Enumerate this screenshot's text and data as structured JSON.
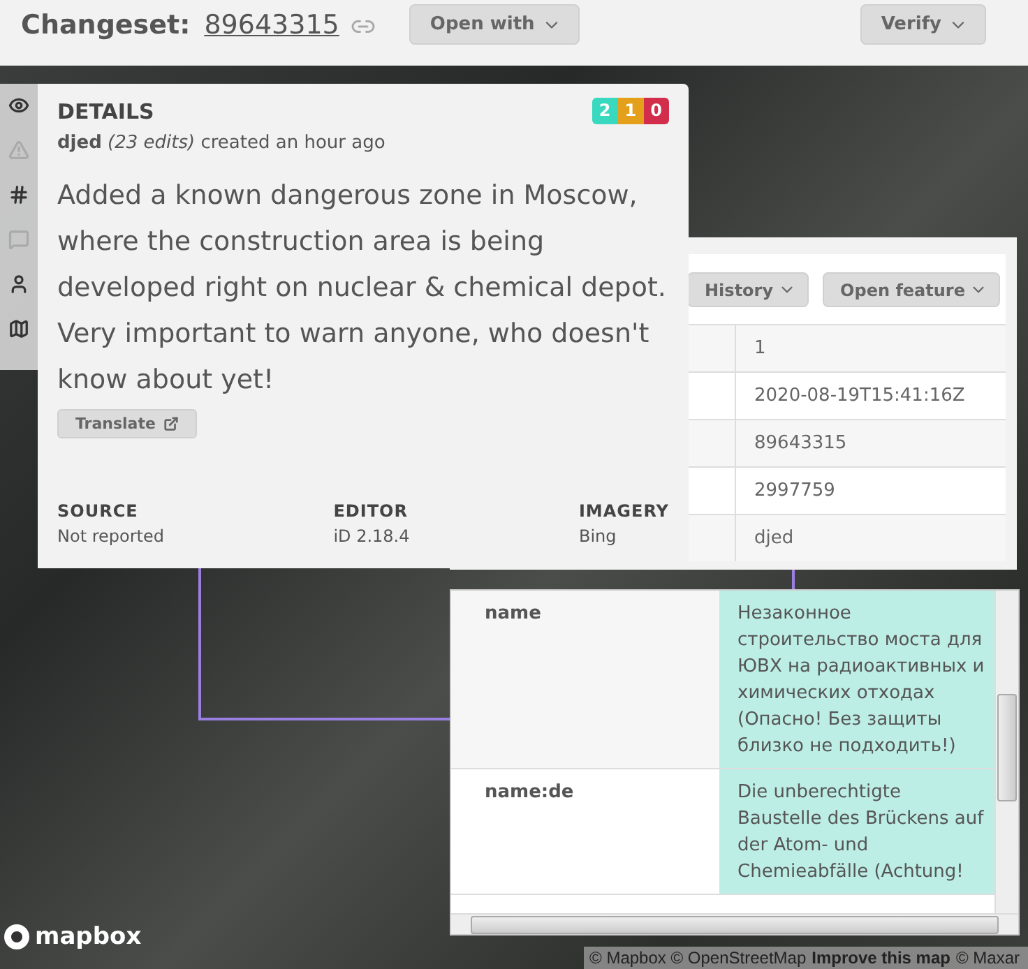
{
  "header": {
    "title": "Changeset:",
    "changeset_id": "89643315",
    "buttons": [
      "Open with",
      "Verify"
    ]
  },
  "details": {
    "title": "DETAILS",
    "badges": [
      {
        "count": "2",
        "color": "#39d9bf"
      },
      {
        "count": "1",
        "color": "#e5a01b"
      },
      {
        "count": "0",
        "color": "#d22e4b"
      }
    ],
    "meta": "**djed** *(23 edits)* created an hour ago",
    "comment": "Added a known dangerous zone in Moscow, where the construction area is being developed right on nuclear & chemical depot. Very important to warn anyone, who doesn't know about yet!",
    "translate_button": "Translate",
    "fields": [
      {
        "label": "SOURCE",
        "value": "Not reported"
      },
      {
        "label": "EDITOR",
        "value": "iD 2.18.4"
      },
      {
        "label": "IMAGERY",
        "value": "Bing"
      }
    ]
  },
  "feature": {
    "buttons": [
      "History",
      "Open feature"
    ],
    "values": [
      "1",
      "2020-08-19T15:41:16Z",
      "89643315",
      "2997759",
      "djed"
    ]
  },
  "tags": {
    "rows": [
      {
        "key": "name",
        "value": "Незаконное строительство моста для ЮВХ на радиоактивных и химических отходах (Опасно! Без защиты близко не подходить!)"
      },
      {
        "key": "name:de",
        "value": "Die unberechtigte Baustelle des Brückens auf der Atom- und Chemieabfälle (Achtung!"
      }
    ]
  },
  "map": {
    "logo": "mapbox",
    "attribution": {
      "before": "© Mapbox © OpenStreetMap",
      "link": "Improve this map",
      "after": "© Maxar"
    }
  }
}
